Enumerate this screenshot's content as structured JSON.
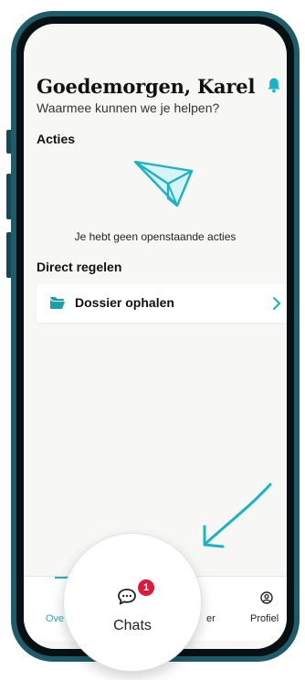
{
  "header": {
    "greeting": "Goedemorgen, Karel",
    "subtitle": "Waarmee kunnen we je helpen?"
  },
  "actions": {
    "title": "Acties",
    "empty_text": "Je hebt geen openstaande acties",
    "illustration_icon": "paper-plane-icon"
  },
  "direct": {
    "title": "Direct regelen",
    "items": [
      {
        "label": "Dossier ophalen",
        "icon": "folder-icon",
        "trailing_icon": "chevron-right-icon"
      }
    ]
  },
  "tabbar": {
    "tabs": [
      {
        "label": "Ove",
        "partial": "t",
        "active": true
      },
      {
        "label": "Chats",
        "badge": "1",
        "icon": "chat-bubble-icon"
      },
      {
        "label": "er",
        "partial": true
      },
      {
        "label": "Profiel",
        "icon": "profile-icon"
      }
    ]
  },
  "colors": {
    "accent": "#1ab3c4",
    "frame": "#1d5c68",
    "badge": "#e0183c",
    "background": "#f7f7f5"
  }
}
